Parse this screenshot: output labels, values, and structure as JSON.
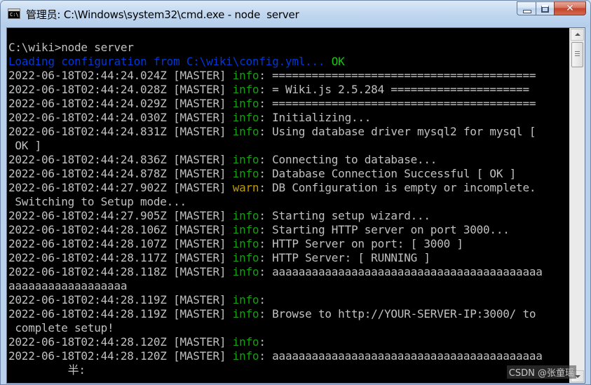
{
  "window": {
    "title": "管理员: C:\\Windows\\system32\\cmd.exe - node  server",
    "icon_label": "C:\\",
    "close_glyph": "✕"
  },
  "console": {
    "lines": [
      [
        {
          "t": "C:\\wiki>node server"
        }
      ],
      [
        {
          "t": "Loading configuration from C:\\wiki\\config.yml... ",
          "c": "blue"
        },
        {
          "t": "OK",
          "c": "ok"
        }
      ],
      [
        {
          "t": "2022-06-18T02:44:24.024Z [MASTER] "
        },
        {
          "t": "info",
          "c": "info"
        },
        {
          "t": ": ========================================"
        }
      ],
      [
        {
          "t": "2022-06-18T02:44:24.028Z [MASTER] "
        },
        {
          "t": "info",
          "c": "info"
        },
        {
          "t": ": = Wiki.js 2.5.284 ====================="
        }
      ],
      [
        {
          "t": "2022-06-18T02:44:24.029Z [MASTER] "
        },
        {
          "t": "info",
          "c": "info"
        },
        {
          "t": ": ========================================"
        }
      ],
      [
        {
          "t": "2022-06-18T02:44:24.030Z [MASTER] "
        },
        {
          "t": "info",
          "c": "info"
        },
        {
          "t": ": Initializing..."
        }
      ],
      [
        {
          "t": "2022-06-18T02:44:24.831Z [MASTER] "
        },
        {
          "t": "info",
          "c": "info"
        },
        {
          "t": ": Using database driver mysql2 for mysql ["
        }
      ],
      [
        {
          "t": " OK ]"
        }
      ],
      [
        {
          "t": "2022-06-18T02:44:24.836Z [MASTER] "
        },
        {
          "t": "info",
          "c": "info"
        },
        {
          "t": ": Connecting to database..."
        }
      ],
      [
        {
          "t": "2022-06-18T02:44:24.878Z [MASTER] "
        },
        {
          "t": "info",
          "c": "info"
        },
        {
          "t": ": Database Connection Successful [ OK ]"
        }
      ],
      [
        {
          "t": "2022-06-18T02:44:27.902Z [MASTER] "
        },
        {
          "t": "warn",
          "c": "warn"
        },
        {
          "t": ": DB Configuration is empty or incomplete."
        }
      ],
      [
        {
          "t": " Switching to Setup mode..."
        }
      ],
      [
        {
          "t": "2022-06-18T02:44:27.905Z [MASTER] "
        },
        {
          "t": "info",
          "c": "info"
        },
        {
          "t": ": Starting setup wizard..."
        }
      ],
      [
        {
          "t": "2022-06-18T02:44:28.106Z [MASTER] "
        },
        {
          "t": "info",
          "c": "info"
        },
        {
          "t": ": Starting HTTP server on port 3000..."
        }
      ],
      [
        {
          "t": "2022-06-18T02:44:28.107Z [MASTER] "
        },
        {
          "t": "info",
          "c": "info"
        },
        {
          "t": ": HTTP Server on port: [ 3000 ]"
        }
      ],
      [
        {
          "t": "2022-06-18T02:44:28.117Z [MASTER] "
        },
        {
          "t": "info",
          "c": "info"
        },
        {
          "t": ": HTTP Server: [ RUNNING ]"
        }
      ],
      [
        {
          "t": "2022-06-18T02:44:28.118Z [MASTER] "
        },
        {
          "t": "info",
          "c": "info"
        },
        {
          "t": ": aaaaaaaaaaaaaaaaaaaaaaaaaaaaaaaaaaaaaaaaa"
        }
      ],
      [
        {
          "t": "aaaaaaaaaaaaaaaaaa"
        }
      ],
      [
        {
          "t": "2022-06-18T02:44:28.119Z [MASTER] "
        },
        {
          "t": "info",
          "c": "info"
        },
        {
          "t": ":"
        }
      ],
      [
        {
          "t": "2022-06-18T02:44:28.119Z [MASTER] "
        },
        {
          "t": "info",
          "c": "info"
        },
        {
          "t": ": Browse to http://YOUR-SERVER-IP:3000/ to"
        }
      ],
      [
        {
          "t": " complete setup!"
        }
      ],
      [
        {
          "t": "2022-06-18T02:44:28.120Z [MASTER] "
        },
        {
          "t": "info",
          "c": "info"
        },
        {
          "t": ":"
        }
      ],
      [
        {
          "t": "2022-06-18T02:44:28.120Z [MASTER] "
        },
        {
          "t": "info",
          "c": "info"
        },
        {
          "t": ": aaaaaaaaaaaaaaaaaaaaaaaaaaaaaaaaaaaaaaaaa"
        }
      ],
      [
        {
          "t": "         半:"
        }
      ]
    ]
  },
  "watermark": "CSDN @张童瑶",
  "colors": {
    "info": "#13a10e",
    "warn": "#c19c00",
    "blue": "#0037da",
    "ok": "#16c60c",
    "default_text": "#c0c0c0",
    "background": "#000000"
  }
}
